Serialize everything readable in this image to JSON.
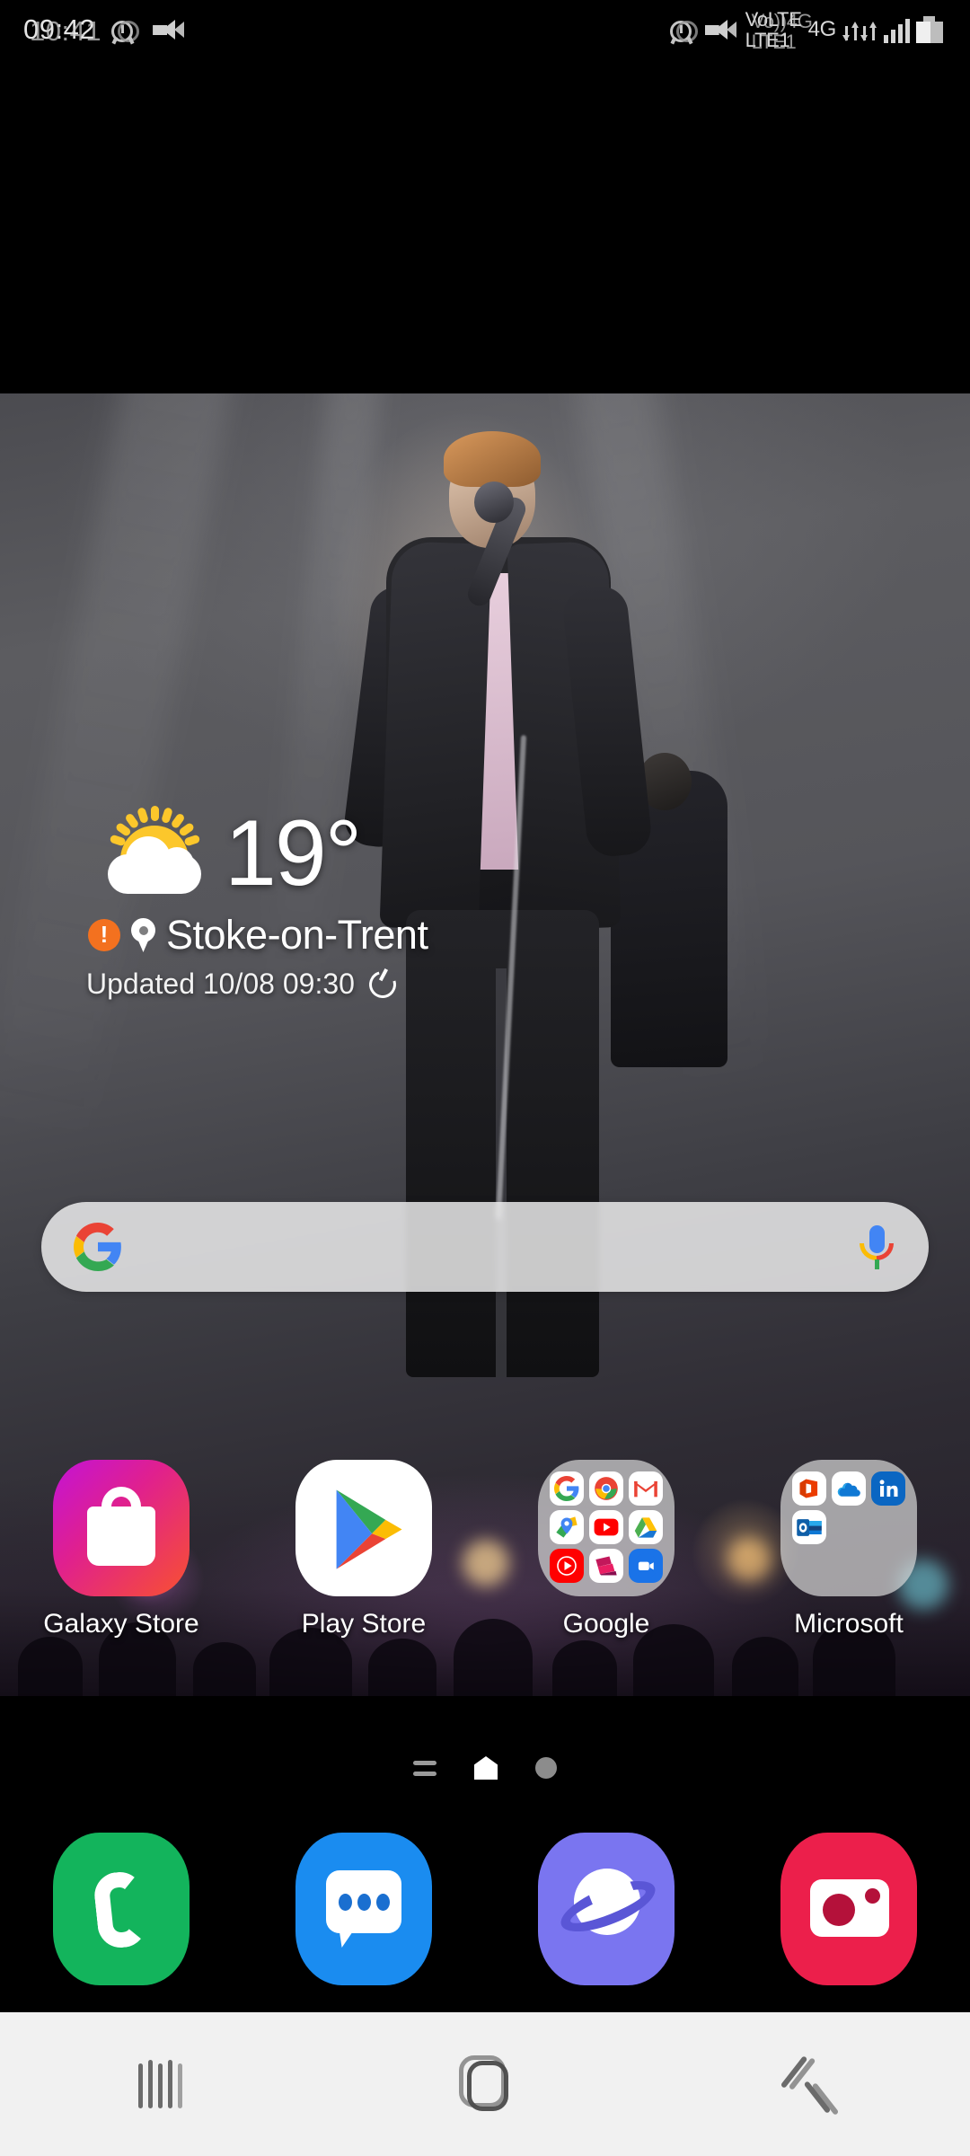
{
  "status_bar": {
    "time": "09:42",
    "time_ghost": "10:41",
    "icons_left": [
      "alarm-icon",
      "mute-icon"
    ],
    "network_label_top": "VoLTE",
    "network_label_bottom": "LTE1",
    "network_ghost_top": "Vo))4G",
    "network_ghost_bottom": "LTE1",
    "generation": "4G",
    "signal_bars": 4,
    "battery_percent": 55
  },
  "weather": {
    "temperature": "19°",
    "icon": "partly-cloudy-icon",
    "alert_symbol": "!",
    "city": "Stoke-on-Trent",
    "updated": "Updated 10/08 09:30",
    "refresh": "refresh-icon"
  },
  "search": {
    "placeholder": "",
    "value": "",
    "logo": "google-g-icon",
    "mic": "google-mic-icon"
  },
  "apps": [
    {
      "label": "Galaxy Store",
      "type": "app",
      "icon": "galaxy-store-icon"
    },
    {
      "label": "Play Store",
      "type": "app",
      "icon": "play-store-icon"
    },
    {
      "label": "Google",
      "type": "folder",
      "items": [
        "google-icon",
        "chrome-icon",
        "gmail-icon",
        "maps-icon",
        "youtube-icon",
        "drive-icon",
        "youtube-music-icon",
        "play-movies-icon",
        "duo-icon"
      ]
    },
    {
      "label": "Microsoft",
      "type": "folder",
      "items": [
        "office-icon",
        "onedrive-icon",
        "linkedin-icon",
        "outlook-icon"
      ]
    }
  ],
  "page_indicators": {
    "items": [
      "feed-page-icon",
      "home-page-icon",
      "other-page-icon"
    ],
    "active_index": 1
  },
  "dock": [
    {
      "label": "Phone",
      "icon": "phone-icon"
    },
    {
      "label": "Messages",
      "icon": "messages-icon"
    },
    {
      "label": "Samsung Internet",
      "icon": "internet-icon"
    },
    {
      "label": "Camera",
      "icon": "camera-icon"
    }
  ],
  "nav_bar": {
    "recents": "recents-icon",
    "home": "home-icon",
    "back": "back-icon"
  },
  "colors": {
    "galaxy_store_start": "#c313d6",
    "galaxy_store_end": "#f8512f",
    "phone": "#13b45c",
    "messages": "#1a8cf0",
    "internet": "#7a75f0",
    "camera": "#ec1f4b",
    "alert": "#f3711f",
    "sun": "#fcc72b",
    "nav_bg": "#f1f1f1"
  }
}
